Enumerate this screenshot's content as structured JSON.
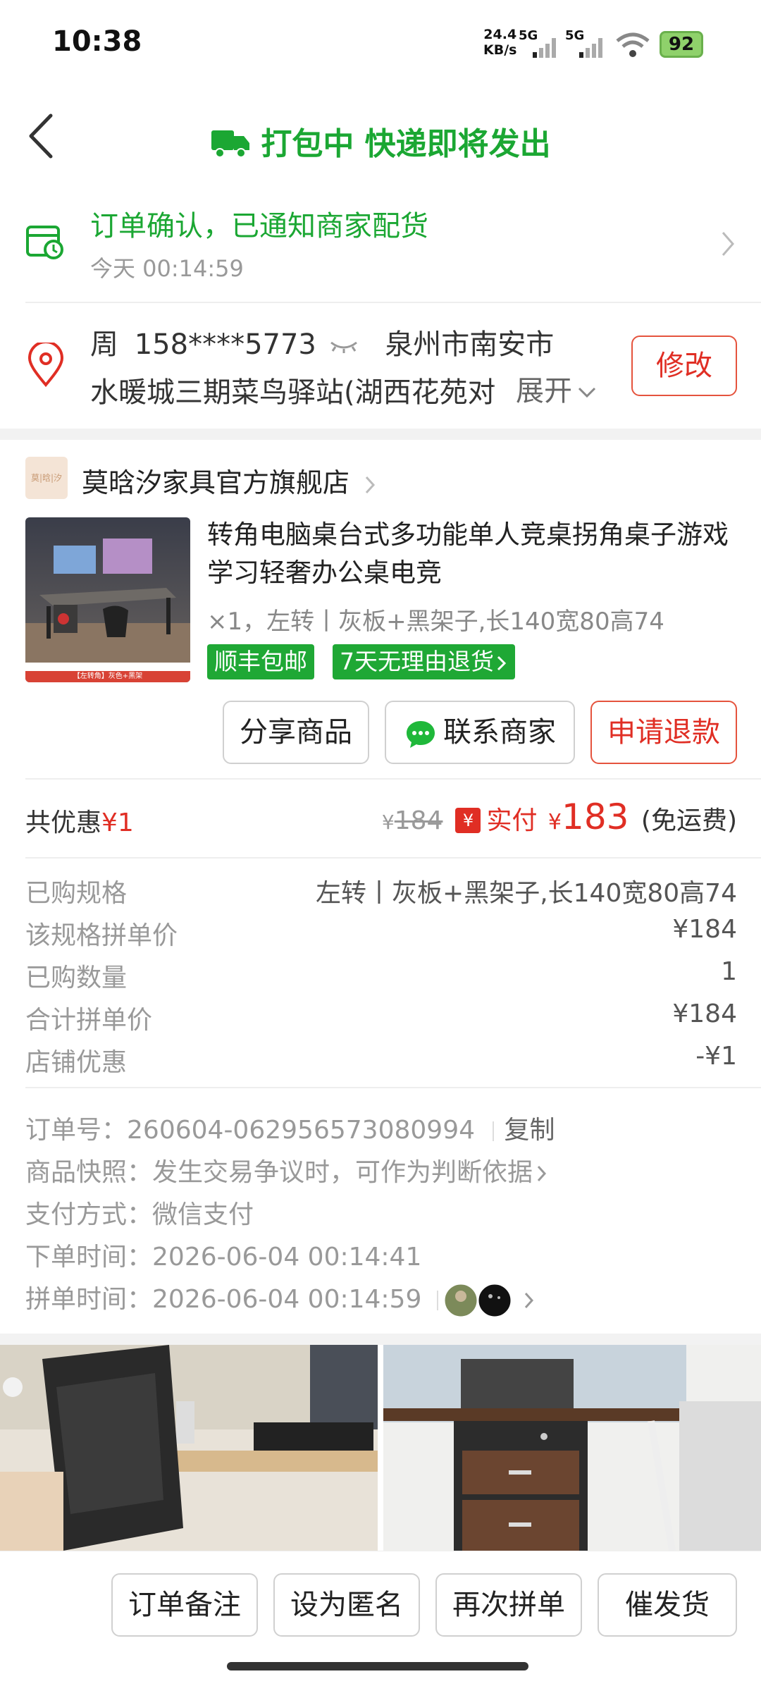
{
  "status_bar": {
    "time": "10:38",
    "net_speed_value": "24.4",
    "net_speed_unit": "KB/s",
    "signal1_label": "5G",
    "signal2_label": "5G",
    "battery": "92"
  },
  "header": {
    "title": "打包中 快递即将发出",
    "icon": "truck-icon"
  },
  "order_status": {
    "message": "订单确认，已通知商家配货",
    "time": "今天 00:14:59"
  },
  "address": {
    "name": "周",
    "phone": "158****5773",
    "city": "泉州市南安市",
    "detail": "水暖城三期菜鸟驿站(湖西花苑对",
    "expand_label": "展开",
    "edit_label": "修改"
  },
  "shop": {
    "logo_text": "莫|晗|汐",
    "name": "莫晗汐家具官方旗舰店"
  },
  "product": {
    "title": "转角电脑桌台式多功能单人竞桌拐角桌子游戏学习轻奢办公桌电竞",
    "spec": "×1，左转丨灰板+黑架子,长140宽80高74",
    "tags": [
      "顺丰包邮",
      "7天无理由退货"
    ],
    "image_caption": "【左转角】灰色+黑架"
  },
  "actions": {
    "share": "分享商品",
    "contact": "联系商家",
    "refund": "申请退款"
  },
  "price": {
    "discount_label": "共优惠",
    "discount_value": "¥1",
    "currency": "¥",
    "original": "184",
    "paid_badge": "¥",
    "paid_label": "实付",
    "paid_currency": "¥",
    "paid_amount": "183",
    "shipping_note": "(免运费)"
  },
  "details": [
    {
      "label": "已购规格",
      "value": "左转丨灰板+黑架子,长140宽80高74"
    },
    {
      "label": "该规格拼单价",
      "value": "¥184"
    },
    {
      "label": "已购数量",
      "value": "1"
    },
    {
      "label": "合计拼单价",
      "value": "¥184"
    },
    {
      "label": "店铺优惠",
      "value": "-¥1"
    }
  ],
  "order_info": {
    "order_no_label": "订单号：",
    "order_no": "260604-062956573080994",
    "copy_label": "复制",
    "snapshot_label": "商品快照：",
    "snapshot_value": "发生交易争议时，可作为判断依据",
    "payment_label": "支付方式：",
    "payment_value": "微信支付",
    "order_time_label": "下单时间：",
    "order_time_value": "2026-06-04 00:14:41",
    "group_time_label": "拼单时间：",
    "group_time_value": "2026-06-04 00:14:59"
  },
  "bottom_bar": {
    "note": "订单备注",
    "anonymous": "设为匿名",
    "regroup": "再次拼单",
    "urge": "催发货"
  },
  "colors": {
    "green": "#1ba733",
    "red": "#e02e24"
  }
}
